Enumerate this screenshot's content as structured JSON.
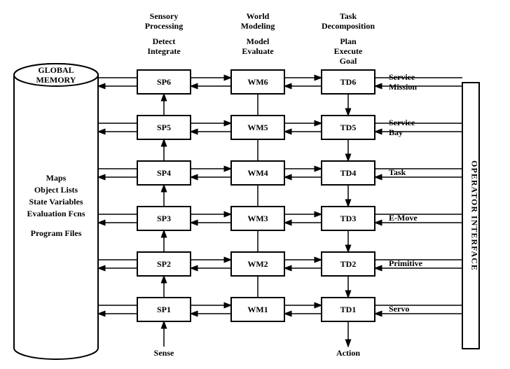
{
  "headers": {
    "sp": {
      "line1": "Sensory",
      "line2": "Processing",
      "line3": "Detect",
      "line4": "Integrate"
    },
    "wm": {
      "line1": "World",
      "line2": "Modeling",
      "line3": "Model",
      "line4": "Evaluate"
    },
    "td": {
      "line1": "Task",
      "line2": "Decomposition",
      "line3": "Plan",
      "line4": "Execute",
      "line5": "Goal"
    }
  },
  "global_memory": {
    "title": "GLOBAL",
    "title2": "MEMORY",
    "items": [
      "Maps",
      "Object Lists",
      "State Variables",
      "Evaluation Fcns",
      "",
      "Program Files"
    ]
  },
  "operator_interface": "OPERATOR INTERFACE",
  "rows": [
    {
      "sp": "SP6",
      "wm": "WM6",
      "td": "TD6",
      "label1": "Service",
      "label2": "Mission"
    },
    {
      "sp": "SP5",
      "wm": "WM5",
      "td": "TD5",
      "label1": "Service",
      "label2": "Bay"
    },
    {
      "sp": "SP4",
      "wm": "WM4",
      "td": "TD4",
      "label1": "Task",
      "label2": ""
    },
    {
      "sp": "SP3",
      "wm": "WM3",
      "td": "TD3",
      "label1": "E-Move",
      "label2": ""
    },
    {
      "sp": "SP2",
      "wm": "WM2",
      "td": "TD2",
      "label1": "Primitive",
      "label2": ""
    },
    {
      "sp": "SP1",
      "wm": "WM1",
      "td": "TD1",
      "label1": "Servo",
      "label2": ""
    }
  ],
  "footer": {
    "sense": "Sense",
    "action": "Action"
  }
}
